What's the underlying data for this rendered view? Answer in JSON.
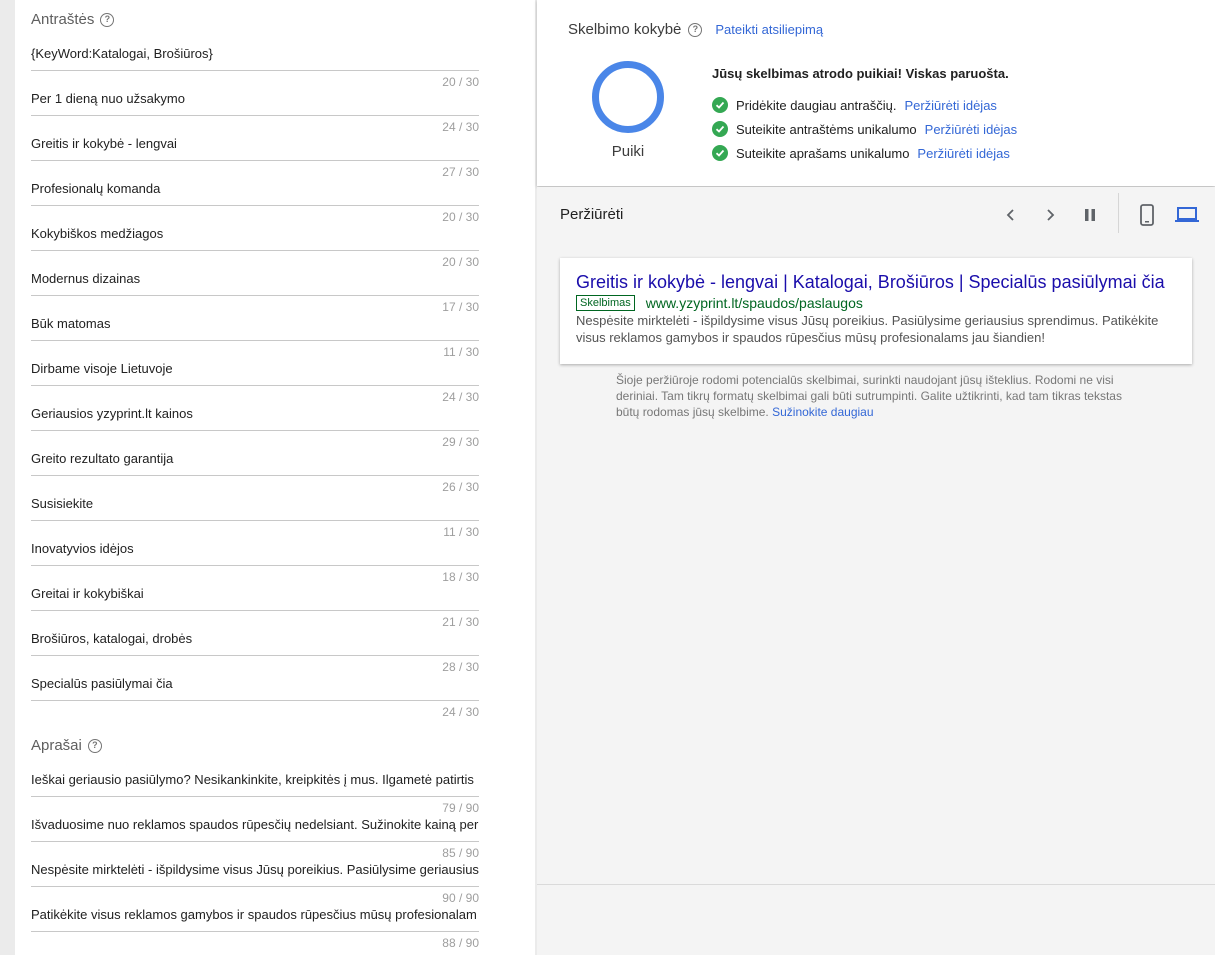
{
  "headlines": {
    "title": "Antraštės",
    "items": [
      {
        "text": "{KeyWord:Katalogai, Brošiūros}",
        "count": "20 / 30"
      },
      {
        "text": "Per 1 dieną nuo užsakymo",
        "count": "24 / 30"
      },
      {
        "text": "Greitis ir kokybė - lengvai",
        "count": "27 / 30"
      },
      {
        "text": "Profesionalų komanda",
        "count": "20 / 30"
      },
      {
        "text": "Kokybiškos medžiagos",
        "count": "20 / 30"
      },
      {
        "text": "Modernus dizainas",
        "count": "17 / 30"
      },
      {
        "text": "Būk matomas",
        "count": "11 / 30"
      },
      {
        "text": "Dirbame visoje Lietuvoje",
        "count": "24 / 30"
      },
      {
        "text": "Geriausios yzyprint.lt kainos",
        "count": "29 / 30"
      },
      {
        "text": "Greito rezultato garantija",
        "count": "26 / 30"
      },
      {
        "text": "Susisiekite",
        "count": "11 / 30"
      },
      {
        "text": "Inovatyvios idėjos",
        "count": "18 / 30"
      },
      {
        "text": "Greitai ir kokybiškai",
        "count": "21 / 30"
      },
      {
        "text": "Brošiūros, katalogai, drobės",
        "count": "28 / 30"
      },
      {
        "text": "Specialūs pasiūlymai čia",
        "count": "24 / 30"
      }
    ]
  },
  "descriptions": {
    "title": "Aprašai",
    "items": [
      {
        "text": "Ieškai geriausio pasiūlymo? Nesikankinkite, kreipkitės į mus. Ilgametė patirtis",
        "count": "79 / 90"
      },
      {
        "text": "Išvaduosime nuo reklamos spaudos rūpesčių nedelsiant. Sužinokite kainą per",
        "count": "85 / 90"
      },
      {
        "text": "Nespėsite mirktelėti - išpildysime visus Jūsų poreikius. Pasiūlysime geriausius",
        "count": "90 / 90"
      },
      {
        "text": "Patikėkite visus reklamos gamybos ir spaudos rūpesčius mūsų profesionalam",
        "count": "88 / 90"
      }
    ]
  },
  "quality": {
    "title": "Skelbimo kokybė",
    "feedback_link": "Pateikti atsiliepimą",
    "rating": "Puiki",
    "summary": "Jūsų skelbimas atrodo puikiai! Viskas paruošta.",
    "tips": [
      {
        "text": "Pridėkite daugiau antraščių.",
        "link": "Peržiūrėti idėjas"
      },
      {
        "text": "Suteikite antraštėms unikalumo",
        "link": "Peržiūrėti idėjas"
      },
      {
        "text": "Suteikite aprašams unikalumo",
        "link": "Peržiūrėti idėjas"
      }
    ],
    "accent_color": "#4a86e8",
    "check_color": "#34a853"
  },
  "preview": {
    "title": "Peržiūrėti",
    "ad": {
      "headline": "Greitis ir kokybė - lengvai | Katalogai, Brošiūros | Specialūs pasiūlymai čia",
      "badge": "Skelbimas",
      "url": "www.yzyprint.lt/spaudos/paslaugos",
      "description": "Nespėsite mirktelėti - išpildysime visus Jūsų poreikius. Pasiūlysime geriausius sprendimus. Patikėkite visus reklamos gamybos ir spaudos rūpesčius mūsų profesionalams jau šiandien!"
    },
    "note": "Šioje peržiūroje rodomi potencialūs skelbimai, surinkti naudojant jūsų išteklius. Rodomi ne visi deriniai. Tam tikrų formatų skelbimai gali būti sutrumpinti. Galite užtikrinti, kad tam tikras tekstas būtų rodomas jūsų skelbime.",
    "note_link": "Sužinokite daugiau",
    "controls": [
      "chevron-left-icon",
      "chevron-right-icon",
      "pause-icon",
      "phone-icon",
      "laptop-icon"
    ]
  }
}
